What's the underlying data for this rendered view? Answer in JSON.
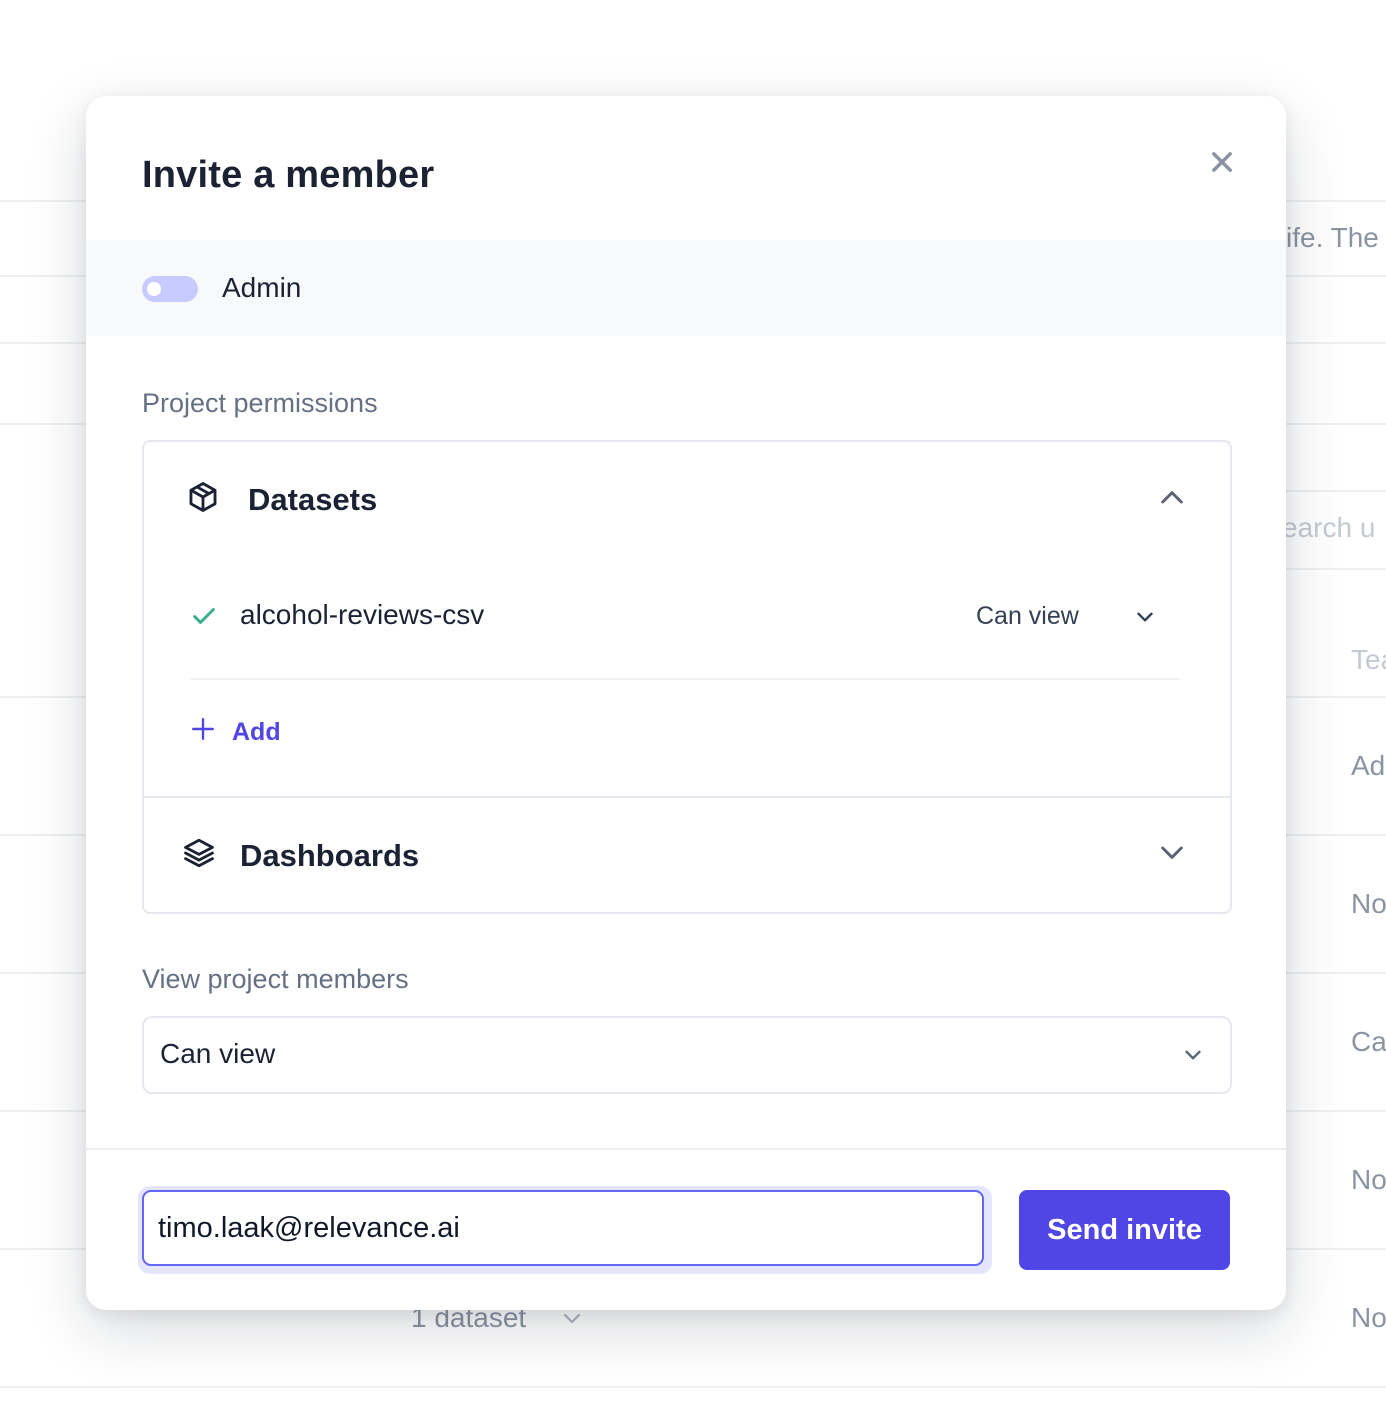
{
  "background": {
    "fragments": {
      "life_text": "ife. The",
      "search_text": "earch u",
      "col_header": "Tea",
      "row_1": "Ad",
      "row_2": "No",
      "row_3": "Ca",
      "row_4": "No",
      "row_5": "No",
      "footer_count": "1 dataset"
    }
  },
  "modal": {
    "title": "Invite a member",
    "close_icon": "close-icon",
    "admin_toggle": {
      "label": "Admin",
      "checked": false,
      "color": "#c7cbff"
    },
    "project_permissions": {
      "label": "Project permissions",
      "sections": [
        {
          "title": "Datasets",
          "icon": "cube-icon",
          "expanded": true,
          "items": [
            {
              "name": "alcohol-reviews-csv",
              "permission": "Can view",
              "selected": true
            }
          ],
          "add_label": "Add"
        },
        {
          "title": "Dashboards",
          "icon": "layers-icon",
          "expanded": false
        }
      ]
    },
    "view_project_members": {
      "label": "View project members",
      "value": "Can view"
    },
    "invite": {
      "email_value": "timo.laak@relevance.ai",
      "send_label": "Send invite"
    }
  },
  "colors": {
    "accent": "#4f46e5",
    "check": "#3fae8f",
    "title_text": "#1a2233",
    "muted_text": "#667085"
  }
}
